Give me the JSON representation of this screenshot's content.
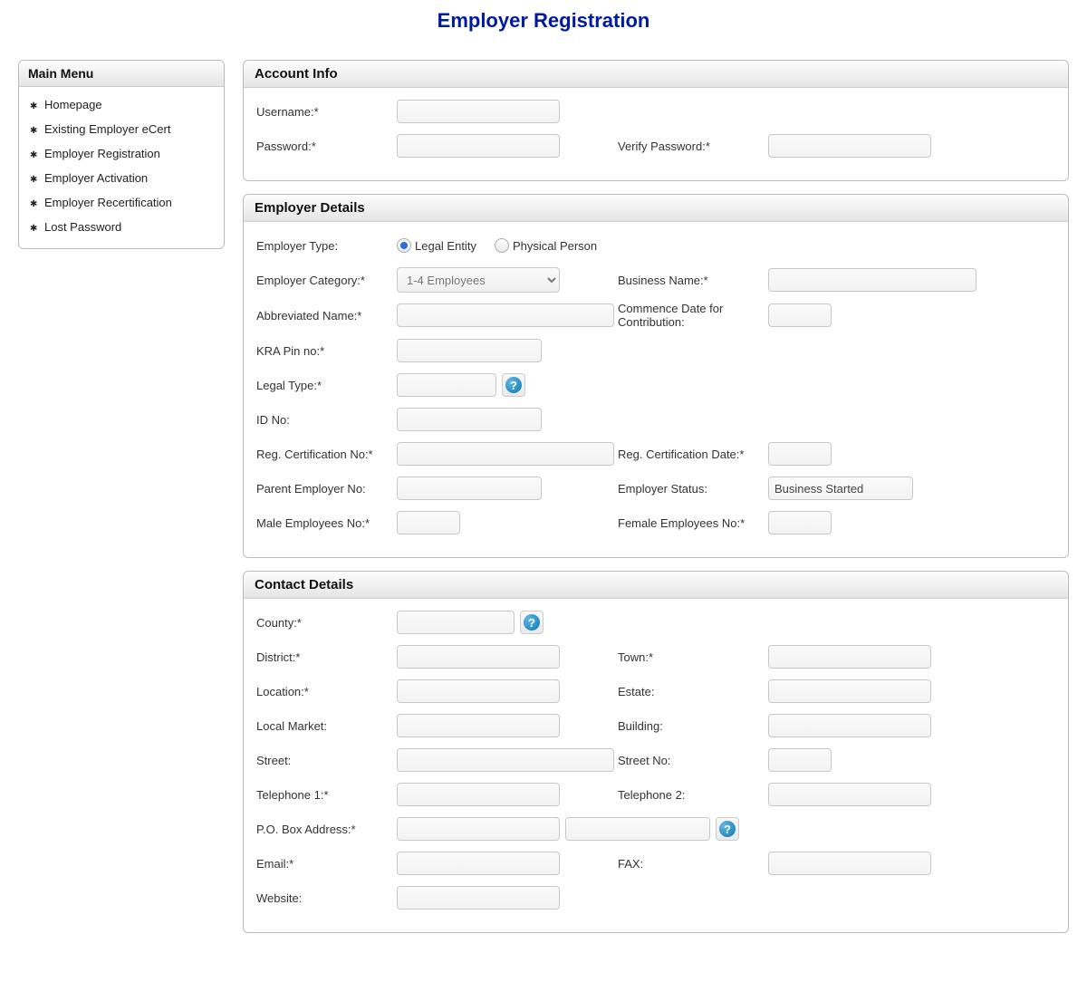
{
  "title": "Employer Registration",
  "sidebar": {
    "header": "Main Menu",
    "items": [
      {
        "label": "Homepage"
      },
      {
        "label": "Existing Employer eCert"
      },
      {
        "label": "Employer Registration"
      },
      {
        "label": "Employer Activation"
      },
      {
        "label": "Employer Recertification"
      },
      {
        "label": "Lost Password"
      }
    ]
  },
  "account": {
    "header": "Account Info",
    "username_label": "Username:*",
    "password_label": "Password:*",
    "verify_label": "Verify Password:*",
    "username_value": "",
    "password_value": "",
    "verify_value": ""
  },
  "employer": {
    "header": "Employer Details",
    "type_label": "Employer Type:",
    "type_legal": "Legal Entity",
    "type_physical": "Physical Person",
    "category_label": "Employer Category:*",
    "category_value": "1-4 Employees",
    "business_name_label": "Business Name:*",
    "business_name_value": "",
    "abbr_label": "Abbreviated Name:*",
    "abbr_value": "",
    "commence_label": "Commence Date for Contribution:",
    "commence_value": "",
    "kra_label": "KRA Pin no:*",
    "kra_value": "",
    "legal_type_label": "Legal Type:*",
    "legal_type_value": "",
    "idno_label": "ID No:",
    "idno_value": "",
    "regcert_label": "Reg. Certification No:*",
    "regcert_value": "",
    "regdate_label": "Reg. Certification Date:*",
    "regdate_value": "",
    "parent_label": "Parent Employer No:",
    "parent_value": "",
    "status_label": "Employer Status:",
    "status_value": "Business Started",
    "male_label": "Male Employees No:*",
    "male_value": "",
    "female_label": "Female Employees No:*",
    "female_value": ""
  },
  "contact": {
    "header": "Contact Details",
    "county_label": "County:*",
    "county_value": "",
    "district_label": "District:*",
    "district_value": "",
    "town_label": "Town:*",
    "town_value": "",
    "location_label": "Location:*",
    "location_value": "",
    "estate_label": "Estate:",
    "estate_value": "",
    "localmarket_label": "Local Market:",
    "localmarket_value": "",
    "building_label": "Building:",
    "building_value": "",
    "street_label": "Street:",
    "street_value": "",
    "streetno_label": "Street No:",
    "streetno_value": "",
    "tel1_label": "Telephone 1:*",
    "tel1_value": "",
    "tel2_label": "Telephone 2:",
    "tel2_value": "",
    "pobox_label": "P.O. Box Address:*",
    "pobox1_value": "",
    "pobox2_value": "",
    "email_label": "Email:*",
    "email_value": "",
    "fax_label": "FAX:",
    "fax_value": "",
    "website_label": "Website:",
    "website_value": ""
  }
}
